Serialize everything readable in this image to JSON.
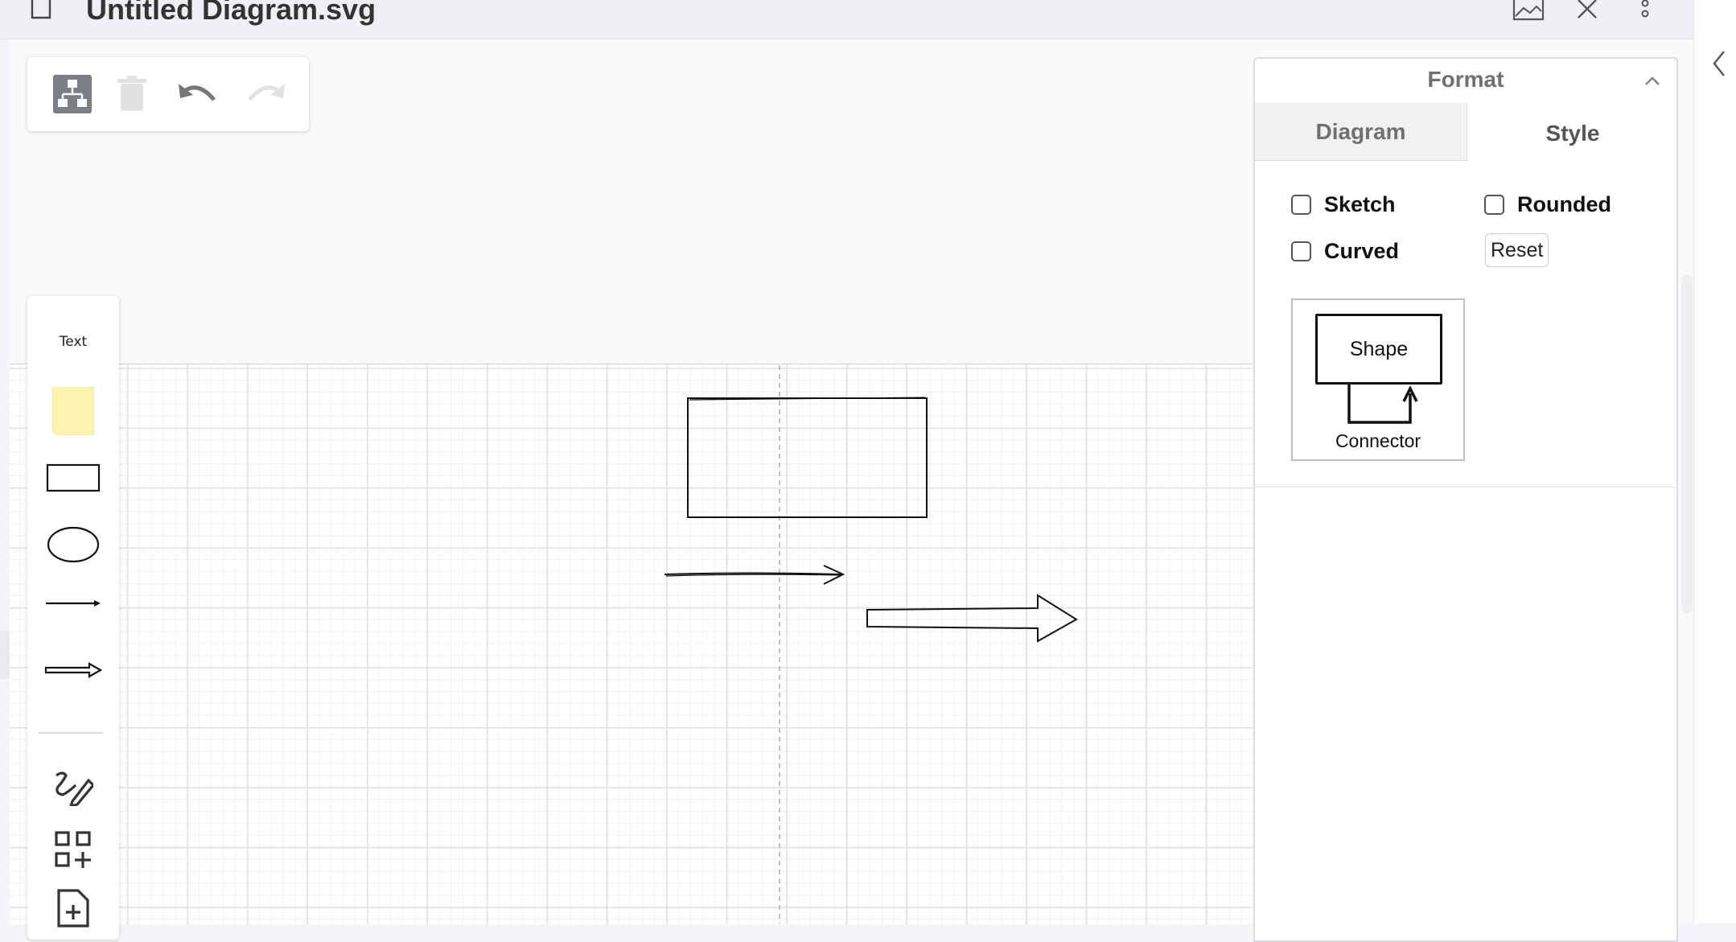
{
  "window": {
    "title": "Untitled Diagram.svg",
    "icons": [
      "document-icon",
      "preview-image-icon",
      "close-icon",
      "more-options-icon",
      "collapse-sidebar-icon"
    ]
  },
  "toolbar": {
    "items": [
      "format-panel-icon",
      "delete-icon",
      "undo-icon",
      "redo-icon"
    ]
  },
  "palette": {
    "text_label": "Text",
    "items": [
      "note-icon",
      "rectangle-icon",
      "ellipse-icon",
      "line-icon",
      "arrow-icon",
      "freehand-draw-icon",
      "more-shapes-icon",
      "insert-page-icon"
    ],
    "note_color": "#fff3b0"
  },
  "format": {
    "title": "Format",
    "tabs": {
      "diagram": "Diagram",
      "style": "Style"
    },
    "options": {
      "sketch": {
        "label": "Sketch",
        "checked": false
      },
      "rounded": {
        "label": "Rounded",
        "checked": false
      },
      "curved": {
        "label": "Curved",
        "checked": false
      }
    },
    "reset_label": "Reset",
    "preview": {
      "shape_label": "Shape",
      "connector_label": "Connector"
    }
  }
}
